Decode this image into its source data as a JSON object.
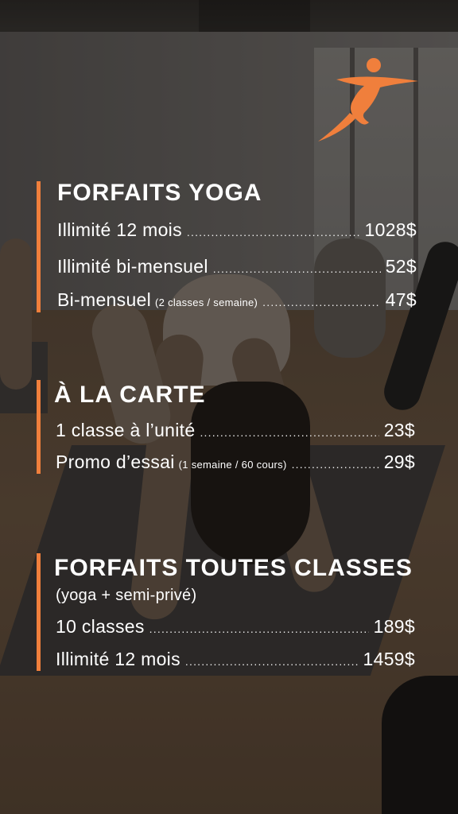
{
  "sections": {
    "yoga": {
      "title": "FORFAITS YOGA",
      "items": [
        {
          "label": "Illimité 12 mois",
          "note": "",
          "price": "1028$"
        },
        {
          "label": "Illimité bi-mensuel",
          "note": "",
          "price": "52$"
        },
        {
          "label": "Bi-mensuel",
          "note": "(2 classes / semaine)",
          "price": "47$"
        }
      ]
    },
    "carte": {
      "title": "À LA CARTE",
      "items": [
        {
          "label": "1 classe à l’unité",
          "note": "",
          "price": "23$"
        },
        {
          "label": "Promo d’essai",
          "note": "(1 semaine / 60 cours)",
          "price": "29$"
        }
      ]
    },
    "all": {
      "title": "FORFAITS TOUTES CLASSES",
      "subtitle": "(yoga + semi-privé)",
      "items": [
        {
          "label": "10 classes",
          "note": "",
          "price": "189$"
        },
        {
          "label": "Illimité 12 mois",
          "note": "",
          "price": "1459$"
        }
      ]
    }
  },
  "logo_icon": "running-figure-icon",
  "colors": {
    "accent": "#f07f3c",
    "text": "#ffffff"
  }
}
